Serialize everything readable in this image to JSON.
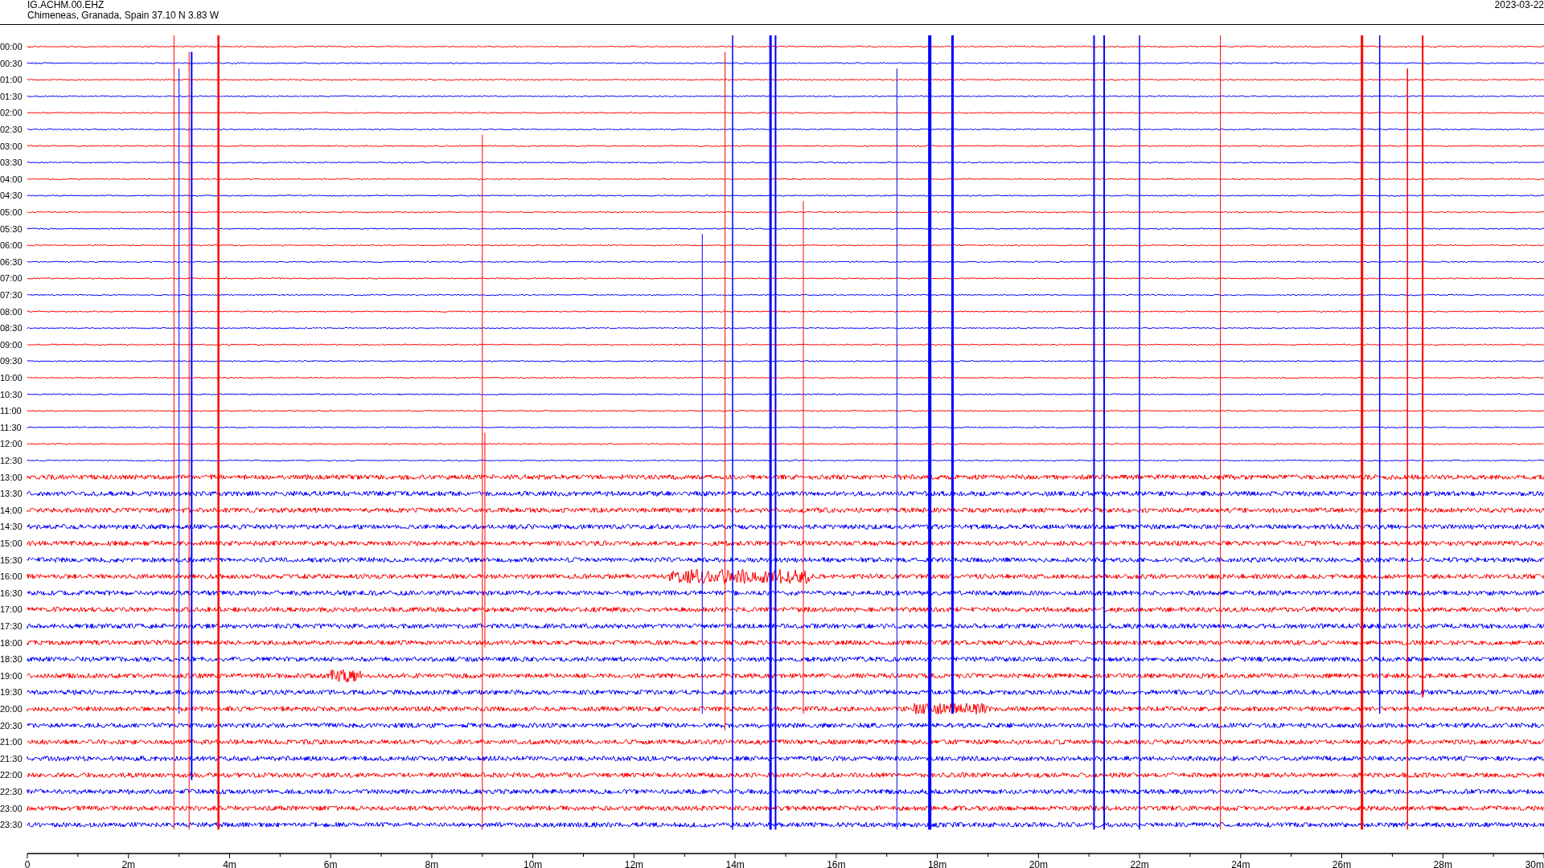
{
  "header": {
    "station": "IG.ACHM.00.EHZ",
    "location": "Chimeneas, Granada, Spain  37.10 N 3.83 W",
    "date": "2023-03-22"
  },
  "rows": [
    {
      "time": "00:00",
      "color": "#ff0000"
    },
    {
      "time": "00:30",
      "color": "#0000ff"
    },
    {
      "time": "01:00",
      "color": "#ff0000"
    },
    {
      "time": "01:30",
      "color": "#0000ff"
    },
    {
      "time": "02:00",
      "color": "#ff0000"
    },
    {
      "time": "02:30",
      "color": "#0000ff"
    },
    {
      "time": "03:00",
      "color": "#ff0000"
    },
    {
      "time": "03:30",
      "color": "#0000ff"
    },
    {
      "time": "04:00",
      "color": "#ff0000"
    },
    {
      "time": "04:30",
      "color": "#0000ff"
    },
    {
      "time": "05:00",
      "color": "#ff0000"
    },
    {
      "time": "05:30",
      "color": "#0000ff"
    },
    {
      "time": "06:00",
      "color": "#ff0000"
    },
    {
      "time": "06:30",
      "color": "#0000ff"
    },
    {
      "time": "07:00",
      "color": "#ff0000"
    },
    {
      "time": "07:30",
      "color": "#0000ff"
    },
    {
      "time": "08:00",
      "color": "#ff0000"
    },
    {
      "time": "08:30",
      "color": "#0000ff"
    },
    {
      "time": "09:00",
      "color": "#ff0000"
    },
    {
      "time": "09:30",
      "color": "#0000ff"
    },
    {
      "time": "10:00",
      "color": "#ff0000"
    },
    {
      "time": "10:30",
      "color": "#0000ff"
    },
    {
      "time": "11:00",
      "color": "#ff0000"
    },
    {
      "time": "11:30",
      "color": "#0000ff"
    },
    {
      "time": "12:00",
      "color": "#ff0000"
    },
    {
      "time": "12:30",
      "color": "#0000ff"
    },
    {
      "time": "13:00",
      "color": "#ff0000"
    },
    {
      "time": "13:30",
      "color": "#0000ff"
    },
    {
      "time": "14:00",
      "color": "#ff0000"
    },
    {
      "time": "14:30",
      "color": "#0000ff"
    },
    {
      "time": "15:00",
      "color": "#ff0000"
    },
    {
      "time": "15:30",
      "color": "#0000ff"
    },
    {
      "time": "16:00",
      "color": "#ff0000"
    },
    {
      "time": "16:30",
      "color": "#0000ff"
    },
    {
      "time": "17:00",
      "color": "#ff0000"
    },
    {
      "time": "17:30",
      "color": "#0000ff"
    },
    {
      "time": "18:00",
      "color": "#ff0000"
    },
    {
      "time": "18:30",
      "color": "#0000ff"
    },
    {
      "time": "19:00",
      "color": "#ff0000"
    },
    {
      "time": "19:30",
      "color": "#0000ff"
    },
    {
      "time": "20:00",
      "color": "#ff0000"
    },
    {
      "time": "20:30",
      "color": "#0000ff"
    },
    {
      "time": "21:00",
      "color": "#ff0000"
    },
    {
      "time": "21:30",
      "color": "#0000ff"
    },
    {
      "time": "22:00",
      "color": "#ff0000"
    },
    {
      "time": "22:30",
      "color": "#0000ff"
    },
    {
      "time": "23:00",
      "color": "#ff0000"
    },
    {
      "time": "23:30",
      "color": "#0000ff"
    }
  ],
  "x_axis": {
    "tick_labels": [
      "0",
      "2m",
      "4m",
      "6m",
      "8m",
      "10m",
      "12m",
      "14m",
      "16m",
      "18m",
      "20m",
      "22m",
      "24m",
      "26m",
      "28m",
      "30m"
    ]
  }
}
